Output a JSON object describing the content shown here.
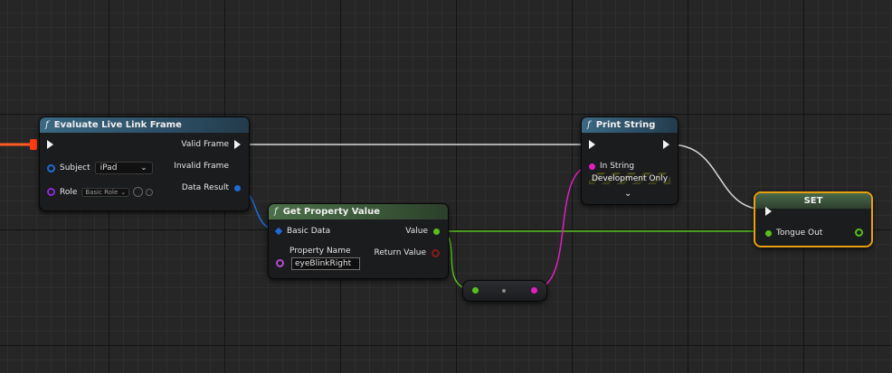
{
  "nodes": {
    "evaluate": {
      "title": "Evaluate Live Link Frame",
      "subject_label": "Subject",
      "subject_value": "iPad",
      "role_label": "Role",
      "role_value": "Basic Role",
      "valid_frame": "Valid Frame",
      "invalid_frame": "Invalid Frame",
      "data_result": "Data Result"
    },
    "get_property": {
      "title": "Get Property Value",
      "basic_data": "Basic Data",
      "property_name_label": "Property Name",
      "property_name_value": "eyeBlinkRight",
      "value": "Value",
      "return_value": "Return Value"
    },
    "print_string": {
      "title": "Print String",
      "in_string": "In String",
      "dev_only": "Development Only"
    },
    "set": {
      "title": "SET",
      "tongue_out": "Tongue Out"
    }
  },
  "icons": {
    "function": "f",
    "chevron": "⌄"
  },
  "colors": {
    "exec_wire": "#d9d9d9",
    "struct_wire": "#1e6bd6",
    "float_wire": "#58c01e",
    "string_wire": "#e01ec4",
    "incoming_wire": "#ff5a1f",
    "selection": "#e8a012"
  }
}
